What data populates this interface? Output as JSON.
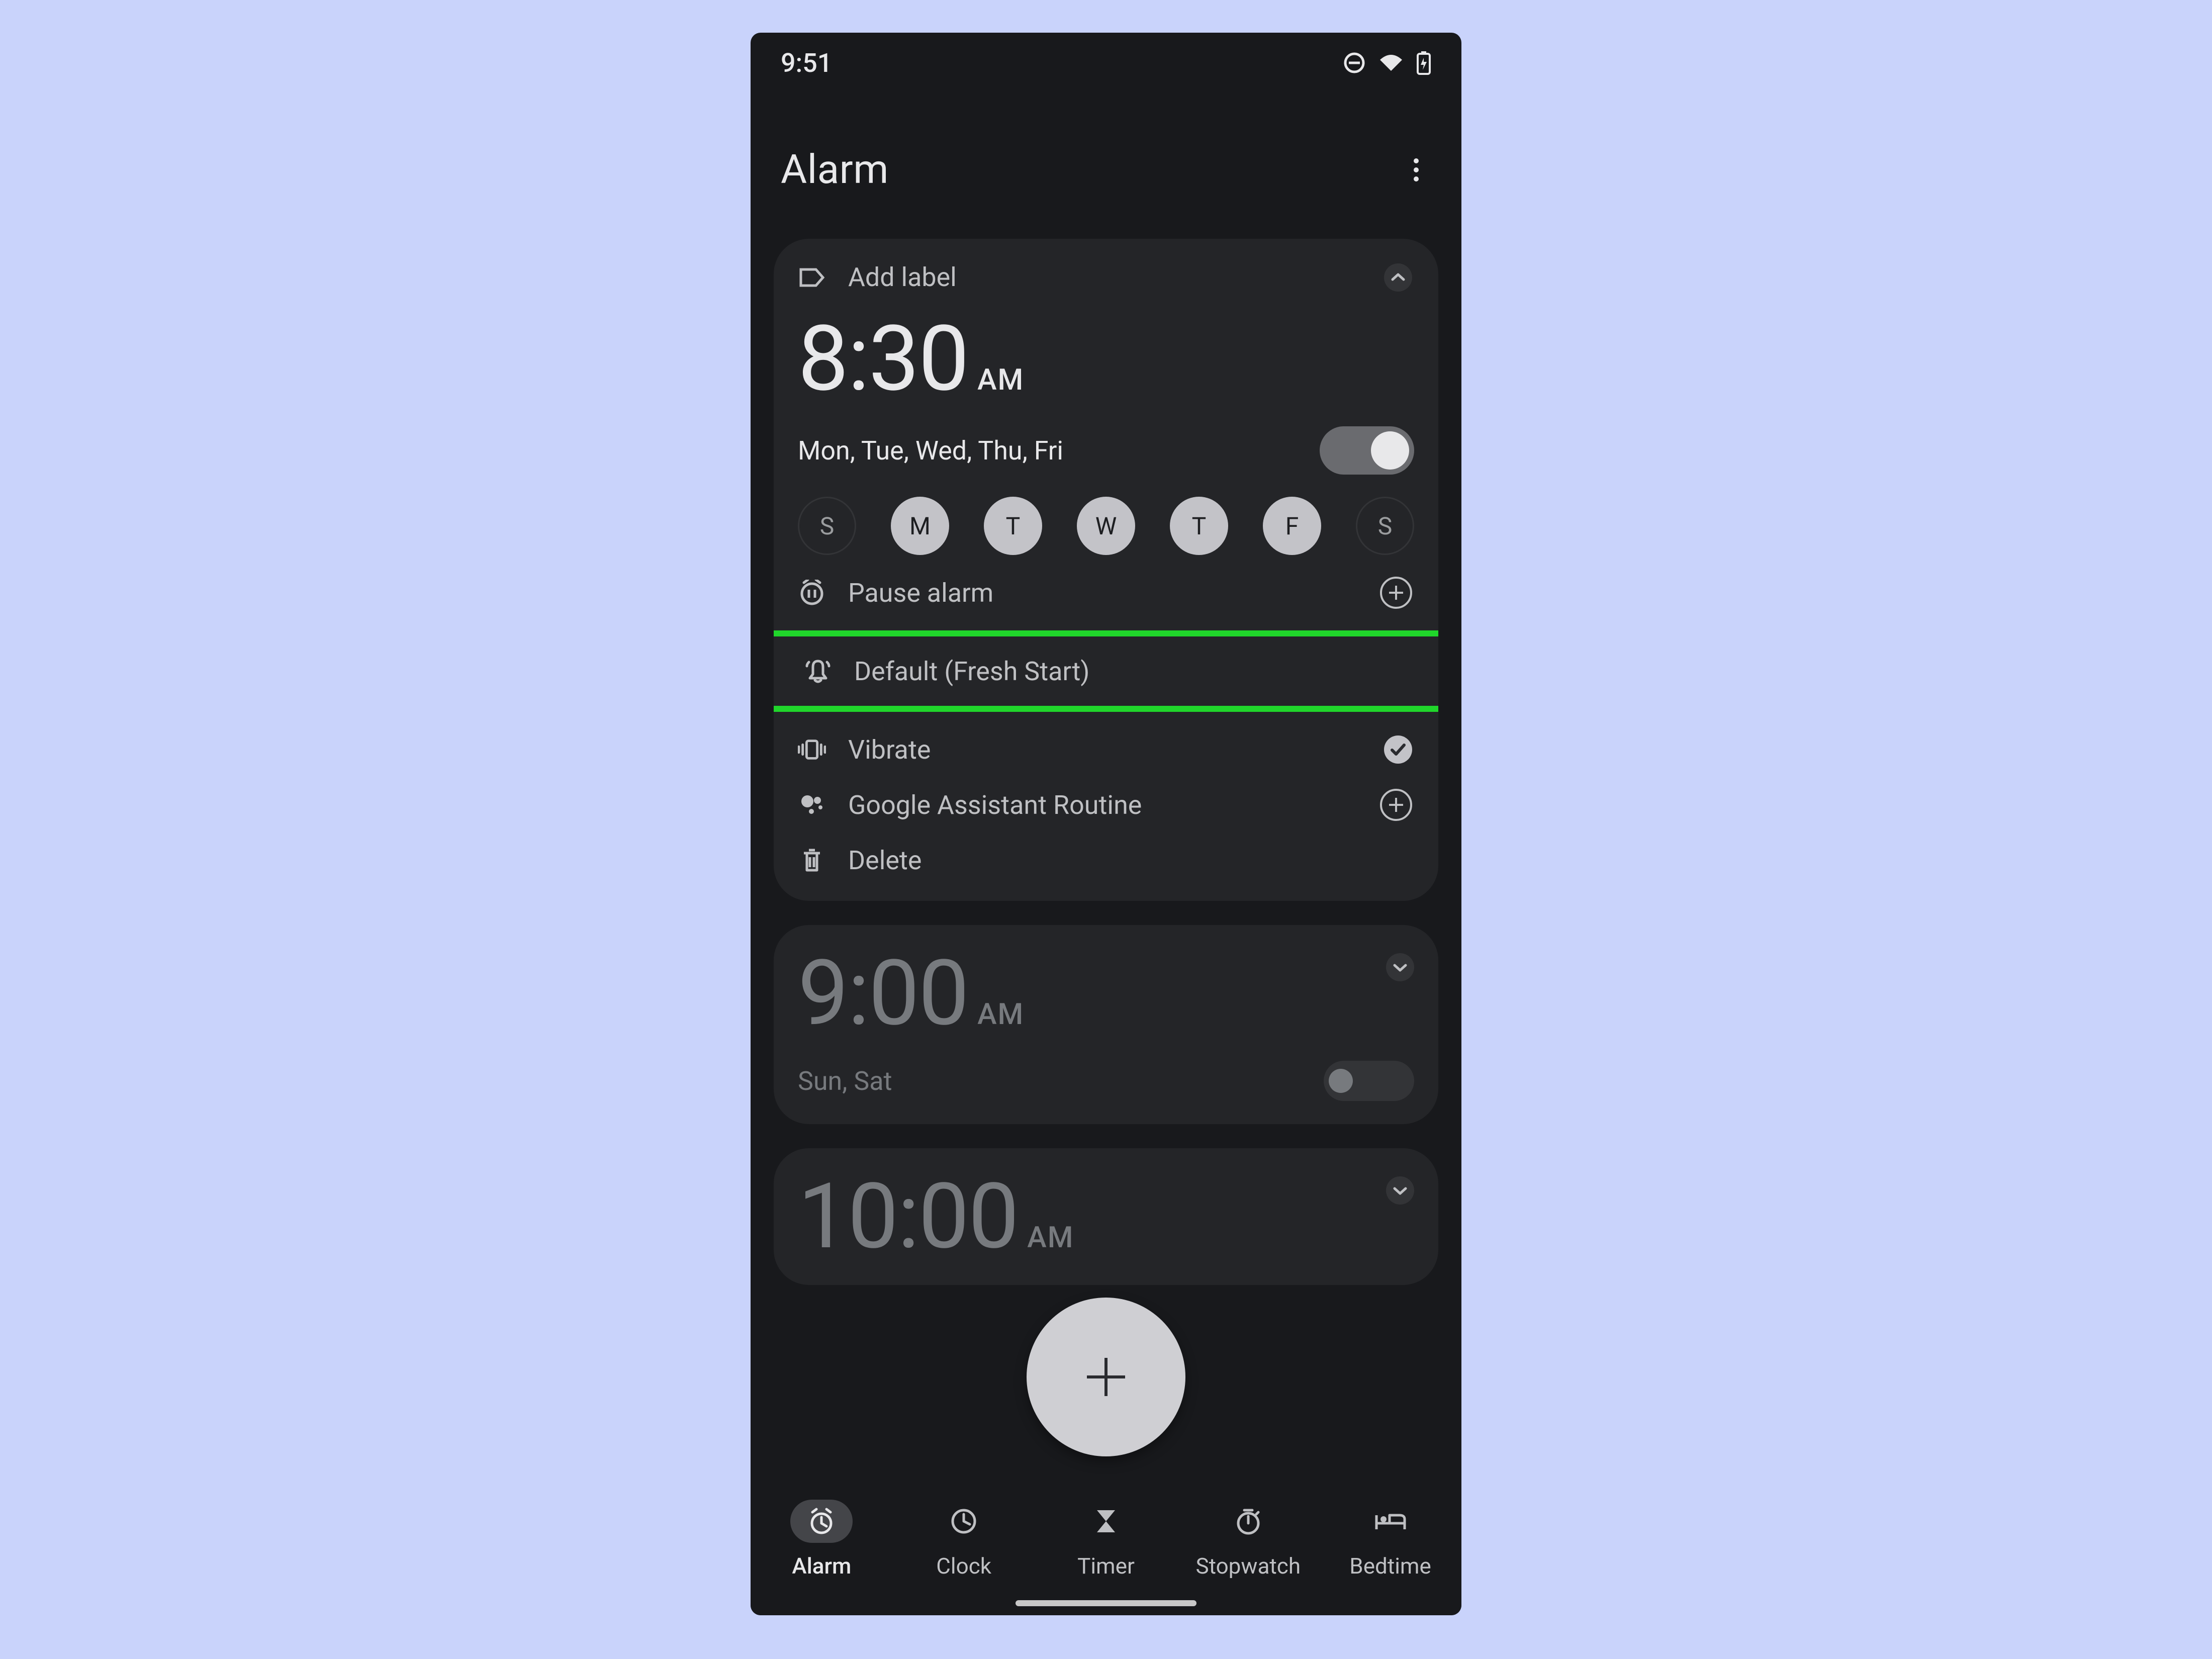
{
  "statusbar": {
    "time": "9:51"
  },
  "header": {
    "title": "Alarm"
  },
  "alarm1": {
    "add_label": "Add label",
    "time_hm": "8:30",
    "time_ampm": "AM",
    "days_text": "Mon, Tue, Wed, Thu, Fri",
    "enabled": true,
    "chips": {
      "sun": "S",
      "mon": "M",
      "tue": "T",
      "wed": "W",
      "thu": "T",
      "fri": "F",
      "sat": "S"
    },
    "pause_label": "Pause alarm",
    "sound_label": "Default (Fresh Start)",
    "vibrate_label": "Vibrate",
    "assistant_label": "Google Assistant Routine",
    "delete_label": "Delete"
  },
  "alarm2": {
    "time_hm": "9:00",
    "time_ampm": "AM",
    "days_text": "Sun, Sat",
    "enabled": false
  },
  "alarm3": {
    "time_hm": "10:00",
    "time_ampm": "AM"
  },
  "nav": {
    "alarm": "Alarm",
    "clock": "Clock",
    "timer": "Timer",
    "stopwatch": "Stopwatch",
    "bedtime": "Bedtime"
  }
}
